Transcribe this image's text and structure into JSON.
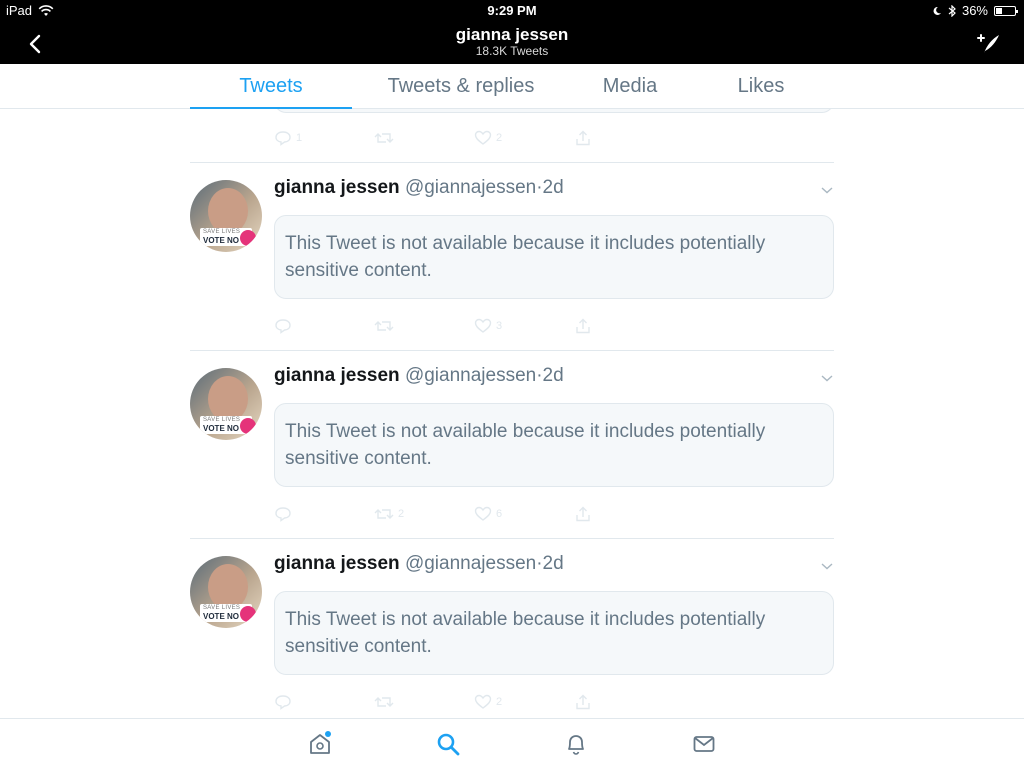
{
  "status_bar": {
    "device": "iPad",
    "time": "9:29 PM",
    "battery_percent_label": "36%",
    "battery_level": 0.36
  },
  "nav": {
    "title": "gianna jessen",
    "subtitle": "18.3K Tweets"
  },
  "tabs": [
    {
      "label": "Tweets",
      "active": true
    },
    {
      "label": "Tweets & replies",
      "active": false
    },
    {
      "label": "Media",
      "active": false
    },
    {
      "label": "Likes",
      "active": false
    }
  ],
  "partial_tweet": {
    "reply_count": "1",
    "retweet_count": "",
    "like_count": "2"
  },
  "tweets": [
    {
      "display_name": "gianna jessen",
      "handle": "@giannajessen",
      "separator": "·",
      "time": "2d",
      "notice": "This Tweet is not available because it includes potentially sensitive content.",
      "avatar_banner_line1": "SAVE LIVES",
      "avatar_banner_line2": "VOTE NO",
      "reply_count": "",
      "retweet_count": "",
      "like_count": "3"
    },
    {
      "display_name": "gianna jessen",
      "handle": "@giannajessen",
      "separator": "·",
      "time": "2d",
      "notice": "This Tweet is not available because it includes potentially sensitive content.",
      "avatar_banner_line1": "SAVE LIVES",
      "avatar_banner_line2": "VOTE NO",
      "reply_count": "",
      "retweet_count": "2",
      "like_count": "6"
    },
    {
      "display_name": "gianna jessen",
      "handle": "@giannajessen",
      "separator": "·",
      "time": "2d",
      "notice": "This Tweet is not available because it includes potentially sensitive content.",
      "avatar_banner_line1": "SAVE LIVES",
      "avatar_banner_line2": "VOTE NO",
      "reply_count": "",
      "retweet_count": "",
      "like_count": "2"
    }
  ],
  "bottom_nav": [
    {
      "icon": "home-icon",
      "active": false,
      "has_dot": true
    },
    {
      "icon": "search-icon",
      "active": true,
      "has_dot": false
    },
    {
      "icon": "bell-icon",
      "active": false,
      "has_dot": false
    },
    {
      "icon": "mail-icon",
      "active": false,
      "has_dot": false
    }
  ],
  "colors": {
    "accent": "#1da1f2",
    "muted": "#657786",
    "border": "#e1e8ed",
    "card_bg": "#f5f8fa"
  }
}
